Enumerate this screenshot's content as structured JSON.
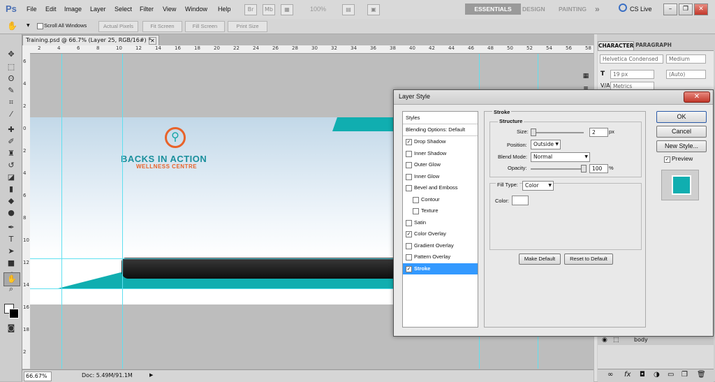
{
  "menubar": {
    "logo": "Ps",
    "items": [
      "File",
      "Edit",
      "Image",
      "Layer",
      "Select",
      "Filter",
      "View",
      "Window",
      "Help"
    ],
    "zoom_value": "100%",
    "workspaces": [
      "ESSENTIALS",
      "DESIGN",
      "PAINTING"
    ],
    "overflow": "»",
    "cs_live": "CS Live"
  },
  "options": {
    "scroll_all_windows": "Scroll All Windows",
    "actual_pixels": "Actual Pixels",
    "fit_screen": "Fit Screen",
    "fill_screen": "Fill Screen",
    "print_size": "Print Size"
  },
  "document": {
    "tab_title": "Training.psd @ 66.7% (Layer 25, RGB/16#) *",
    "logo_title": "BACKS IN ACTION",
    "logo_subtitle": "WELLNESS CENTRE",
    "ruler_top": [
      "2",
      "4",
      "6",
      "8",
      "10",
      "12",
      "14",
      "16",
      "18",
      "20",
      "22",
      "24",
      "26",
      "28",
      "30",
      "32",
      "34",
      "36",
      "38",
      "40",
      "42",
      "44",
      "46",
      "48",
      "50",
      "52",
      "54",
      "56",
      "58"
    ],
    "ruler_left": [
      "6",
      "4",
      "2",
      "0",
      "2",
      "4",
      "6",
      "8",
      "10",
      "12",
      "14",
      "16",
      "18",
      "2"
    ]
  },
  "status": {
    "zoom": "66.67%",
    "doc_info": "Doc: 5.49M/91.1M"
  },
  "character_panel": {
    "tab_character": "CHARACTER",
    "tab_paragraph": "PARAGRAPH",
    "font_family": "Helvetica Condensed",
    "font_style": "Medium",
    "font_size": "19 px",
    "leading": "(Auto)",
    "kerning": "Metrics"
  },
  "layers_panel": {
    "layer_name": "body"
  },
  "dialog": {
    "title": "Layer Style",
    "styles_header": "Styles",
    "blending": "Blending Options: Default",
    "items": [
      {
        "label": "Drop Shadow",
        "checked": true
      },
      {
        "label": "Inner Shadow",
        "checked": false
      },
      {
        "label": "Outer Glow",
        "checked": false
      },
      {
        "label": "Inner Glow",
        "checked": false
      },
      {
        "label": "Bevel and Emboss",
        "checked": false
      },
      {
        "label": "Contour",
        "checked": false
      },
      {
        "label": "Texture",
        "checked": false
      },
      {
        "label": "Satin",
        "checked": false
      },
      {
        "label": "Color Overlay",
        "checked": true
      },
      {
        "label": "Gradient Overlay",
        "checked": false
      },
      {
        "label": "Pattern Overlay",
        "checked": false
      },
      {
        "label": "Stroke",
        "checked": true
      }
    ],
    "stroke": {
      "group_title": "Stroke",
      "structure_title": "Structure",
      "size_label": "Size:",
      "size_value": "2",
      "size_unit": "px",
      "position_label": "Position:",
      "position_value": "Outside",
      "blend_label": "Blend Mode:",
      "blend_value": "Normal",
      "opacity_label": "Opacity:",
      "opacity_value": "100",
      "opacity_unit": "%",
      "fill_type_label": "Fill Type:",
      "fill_type_value": "Color",
      "color_label": "Color:",
      "make_default": "Make Default",
      "reset_default": "Reset to Default"
    },
    "buttons": {
      "ok": "OK",
      "reset": "Cancel",
      "new_style": "New Style...",
      "preview": "Preview"
    }
  },
  "colors": {
    "teal": "#10aeb0",
    "logo_orange": "#e8632a",
    "logo_teal": "#1a8f9c",
    "selection_blue": "#3399ff"
  }
}
